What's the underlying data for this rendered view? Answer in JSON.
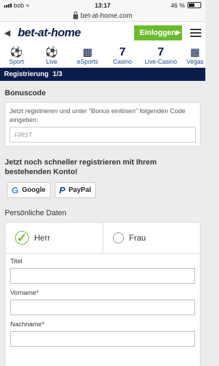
{
  "status": {
    "carrier": "bob",
    "time": "13:17",
    "battery": "46 %"
  },
  "browser": {
    "url": "bet-at-home.com"
  },
  "header": {
    "logo": "bet-at-home",
    "login_label": "Einloggen"
  },
  "nav": {
    "items": [
      {
        "label": "Sport",
        "icon": "soccer-ball-icon"
      },
      {
        "label": "Live",
        "icon": "live-ball-icon"
      },
      {
        "label": "eSports",
        "icon": "gamepad-icon"
      },
      {
        "label": "Casino",
        "icon": "seven-icon"
      },
      {
        "label": "Live-Casino",
        "icon": "live-seven-icon"
      },
      {
        "label": "Vegas",
        "icon": "slot-machine-icon"
      }
    ]
  },
  "page": {
    "title": "Registrierung",
    "step": "1/3"
  },
  "bonus": {
    "title": "Bonuscode",
    "description": "Jetzt registrieren und unter \"Bonus einlösen\" folgenden Code eingeben:",
    "placeholder": "FIRST"
  },
  "social": {
    "title": "Jetzt noch schneller registrieren mit Ihrem bestehenden Konto!",
    "google_label": "Google",
    "paypal_label": "PayPal"
  },
  "personal": {
    "title": "Persönliche Daten",
    "gender_male": "Herr",
    "gender_female": "Frau",
    "fields": {
      "title": "Titel",
      "firstname": "Vorname*",
      "lastname": "Nachname*"
    }
  },
  "colors": {
    "brand": "#0a1d4a",
    "accent": "#6cbb2f"
  }
}
